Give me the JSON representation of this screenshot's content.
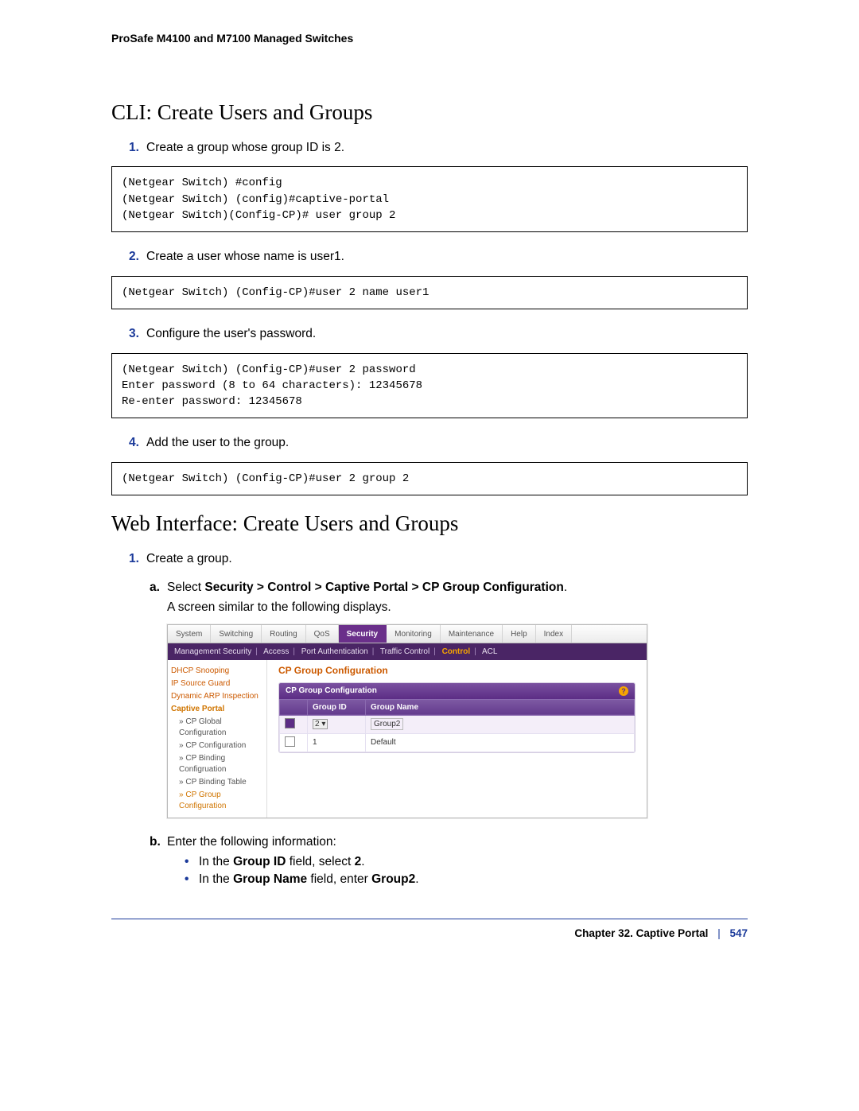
{
  "header": "ProSafe M4100 and M7100 Managed Switches",
  "section1_title": "CLI: Create Users and Groups",
  "steps": {
    "s1": {
      "num": "1.",
      "text": "Create a group whose group ID is 2."
    },
    "s2": {
      "num": "2.",
      "text": "Create a user whose name is user1."
    },
    "s3": {
      "num": "3.",
      "text": "Configure the user's password."
    },
    "s4": {
      "num": "4.",
      "text": "Add the user to the group."
    }
  },
  "code": {
    "c1": "(Netgear Switch) #config\n(Netgear Switch) (config)#captive-portal\n(Netgear Switch)(Config-CP)# user group 2",
    "c2": "(Netgear Switch) (Config-CP)#user 2 name user1",
    "c3": "(Netgear Switch) (Config-CP)#user 2 password\nEnter password (8 to 64 characters): 12345678\nRe-enter password: 12345678",
    "c4": "(Netgear Switch) (Config-CP)#user 2 group 2"
  },
  "section2_title": "Web Interface: Create Users and Groups",
  "web": {
    "s1": {
      "num": "1.",
      "text": "Create a group."
    },
    "a_lbl": "a.",
    "a_prefix": "Select ",
    "a_path": "Security > Control > Captive Portal > CP Group Configuration",
    "a_suffix": ".",
    "similar": "A screen similar to the following displays.",
    "b_lbl": "b.",
    "b_text": "Enter the following information:",
    "b1_prefix": "In the ",
    "b1_field": "Group ID",
    "b1_mid": " field, select ",
    "b1_val": "2",
    "b1_end": ".",
    "b2_prefix": "In the ",
    "b2_field": "Group Name",
    "b2_mid": " field, enter ",
    "b2_val": "Group2",
    "b2_end": "."
  },
  "ui": {
    "tabs": [
      "System",
      "Switching",
      "Routing",
      "QoS",
      "Security",
      "Monitoring",
      "Maintenance",
      "Help",
      "Index"
    ],
    "active_tab": "Security",
    "subnav": [
      "Management Security",
      "Access",
      "Port Authentication",
      "Traffic Control",
      "Control",
      "ACL"
    ],
    "subnav_active": "Control",
    "side": {
      "items": [
        "DHCP Snooping",
        "IP Source Guard",
        "Dynamic ARP Inspection",
        "Captive Portal"
      ],
      "children": [
        "CP Global Configuration",
        "CP Configuration",
        "CP Binding Configruation",
        "CP Binding Table",
        "CP Group Configuration"
      ]
    },
    "panel_title": "CP Group Configuration",
    "panel_head": "CP Group Configuration",
    "columns": {
      "c0": "",
      "c1": "Group ID",
      "c2": "Group Name"
    },
    "rows": {
      "input": {
        "id": "2",
        "name": "Group2"
      },
      "r1": {
        "id": "1",
        "name": "Default"
      }
    }
  },
  "footer": {
    "chapter": "Chapter 32.  Captive Portal",
    "page": "547"
  }
}
